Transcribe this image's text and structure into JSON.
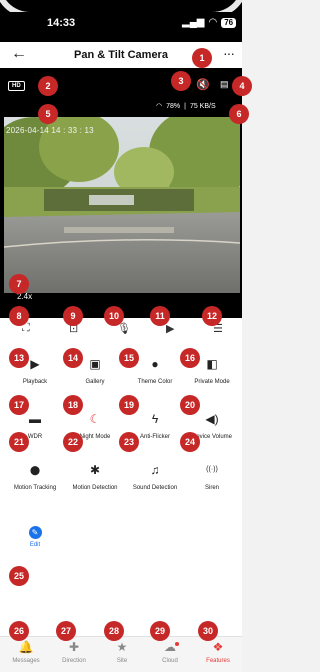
{
  "status_bar": {
    "time": "14:33",
    "signal": "▂▄▆",
    "wifi": "◠",
    "battery": "76"
  },
  "header": {
    "title": "Pan & Tilt Camera"
  },
  "video": {
    "quality_badge": "HD",
    "wifi_strength": "78%",
    "bitrate": "75 KB/S",
    "timestamp": "2026-04-14   14 : 33 : 13",
    "zoom": "2.4x"
  },
  "controls": [
    {
      "name": "fullscreen",
      "icon": "⛶"
    },
    {
      "name": "screenshot",
      "icon": "⊡"
    },
    {
      "name": "microphone",
      "icon": "🎙"
    },
    {
      "name": "record",
      "icon": "▶"
    },
    {
      "name": "collapse",
      "icon": "☰"
    }
  ],
  "features": [
    {
      "label": "Playback",
      "icon": "▶",
      "icon_name": "play-circle-icon"
    },
    {
      "label": "Gallery",
      "icon": "▣",
      "icon_name": "image-icon"
    },
    {
      "label": "Theme Color",
      "icon": "●",
      "icon_name": "palette-icon"
    },
    {
      "label": "Private Mode",
      "icon": "◧",
      "icon_name": "shield-half-icon"
    },
    {
      "label": "WDR",
      "icon": "▬",
      "icon_name": "wdr-icon"
    },
    {
      "label": "Night Mode",
      "icon": "☾",
      "icon_name": "night-mode-icon"
    },
    {
      "label": "Anti-Flicker",
      "icon": "ϟ",
      "icon_name": "flash-icon"
    },
    {
      "label": "Device Volume",
      "icon": "◀)",
      "icon_name": "volume-icon"
    },
    {
      "label": "Motion Tracking",
      "icon": "⬤",
      "icon_name": "location-pin-icon"
    },
    {
      "label": "Motion Detection",
      "icon": "✱",
      "icon_name": "person-motion-icon"
    },
    {
      "label": "Sound Detection",
      "icon": "♫",
      "icon_name": "microphone-icon"
    },
    {
      "label": "Siren",
      "icon": "((·))",
      "icon_name": "siren-icon"
    },
    {
      "label": "Edit",
      "icon": "✎",
      "icon_name": "pencil-icon"
    }
  ],
  "tabs": [
    {
      "label": "Messages",
      "icon": "🔔",
      "icon_name": "bell-icon"
    },
    {
      "label": "Direction",
      "icon": "✚",
      "icon_name": "direction-pad-icon"
    },
    {
      "label": "Site",
      "icon": "★",
      "icon_name": "star-icon"
    },
    {
      "label": "Cloud",
      "icon": "☁",
      "icon_name": "cloud-icon"
    },
    {
      "label": "Features",
      "icon": "❖",
      "icon_name": "features-icon"
    }
  ],
  "markers": [
    "1",
    "2",
    "3",
    "4",
    "5",
    "6",
    "7",
    "8",
    "9",
    "10",
    "11",
    "12",
    "13",
    "14",
    "15",
    "16",
    "17",
    "18",
    "19",
    "20",
    "21",
    "22",
    "23",
    "24",
    "25",
    "26",
    "27",
    "28",
    "29",
    "30"
  ],
  "colors": {
    "accent": "#e53935",
    "edit_blue": "#1a73e8",
    "marker": "#c62828"
  }
}
